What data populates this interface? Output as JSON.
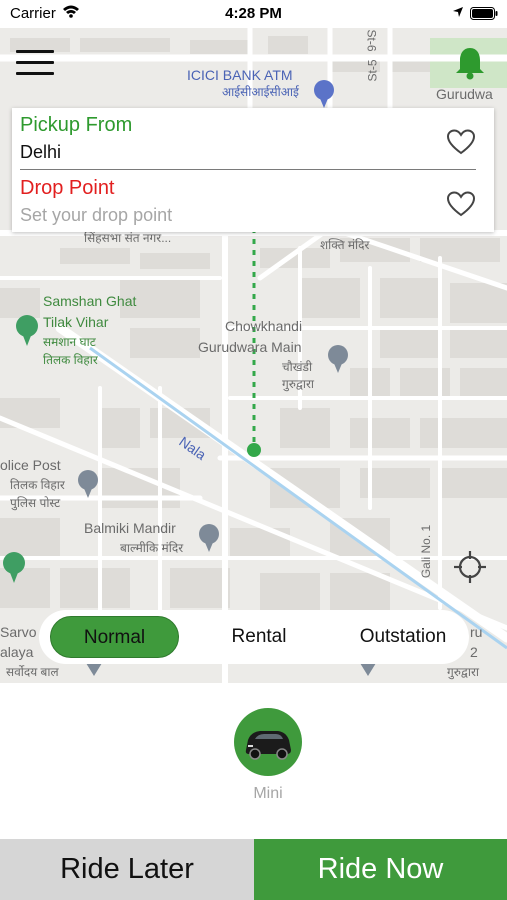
{
  "status_bar": {
    "carrier": "Carrier",
    "time": "4:28 PM"
  },
  "map": {
    "labels": {
      "icici": "ICICI BANK ATM",
      "icici_hi": "आईसीआईसीआई",
      "gurudwara_top": "Gurudwa",
      "st6": "St-6",
      "st5": "St-5",
      "singhsabha": "सिंहसभा संत नगर...",
      "shakti": "शक्ति मंदिर",
      "samshan": "Samshan Ghat",
      "tilak": "Tilak Vihar",
      "samshan_hi": "समशान घाट",
      "tilak_hi": "तिलक विहार",
      "chowkhandi": "Chowkhandi",
      "gurudwara_main": "Gurudwara Main",
      "chowkhandi_hi": "चौखंडी",
      "gurudwara_hi": "गुरुद्वारा",
      "nala": "Nala",
      "police": "olice Post",
      "tilak_hi2": "तिलक विहार",
      "police_hi": "पुलिस पोस्ट",
      "balmiki": "Balmiki Mandir",
      "balmiki_hi": "बाल्मीकि मंदिर",
      "gali": "Gali No. 1",
      "sarvo": "Sarvo",
      "alaya": "alaya",
      "sarvoday_hi": "सर्वोदय बाल",
      "ru": "ru",
      "num2": "2",
      "gurudwara_br": "गुरुद्वारा"
    }
  },
  "location_card": {
    "pickup_title": "Pickup From",
    "pickup_value": "Delhi",
    "drop_title": "Drop Point",
    "drop_placeholder": "Set your drop point"
  },
  "tabs": [
    "Normal",
    "Rental",
    "Outstation"
  ],
  "vehicle": {
    "label": "Mini"
  },
  "buttons": {
    "ride_later": "Ride Later",
    "ride_now": "Ride Now"
  },
  "icons": {
    "menu": "hamburger-menu-icon",
    "bell": "bell-icon",
    "heart": "heart-outline-icon",
    "locate": "crosshair-icon",
    "car": "car-icon"
  },
  "colors": {
    "accent_green": "#3f9a3c",
    "pickup_green": "#2e9a2e",
    "drop_red": "#e21f1f"
  }
}
